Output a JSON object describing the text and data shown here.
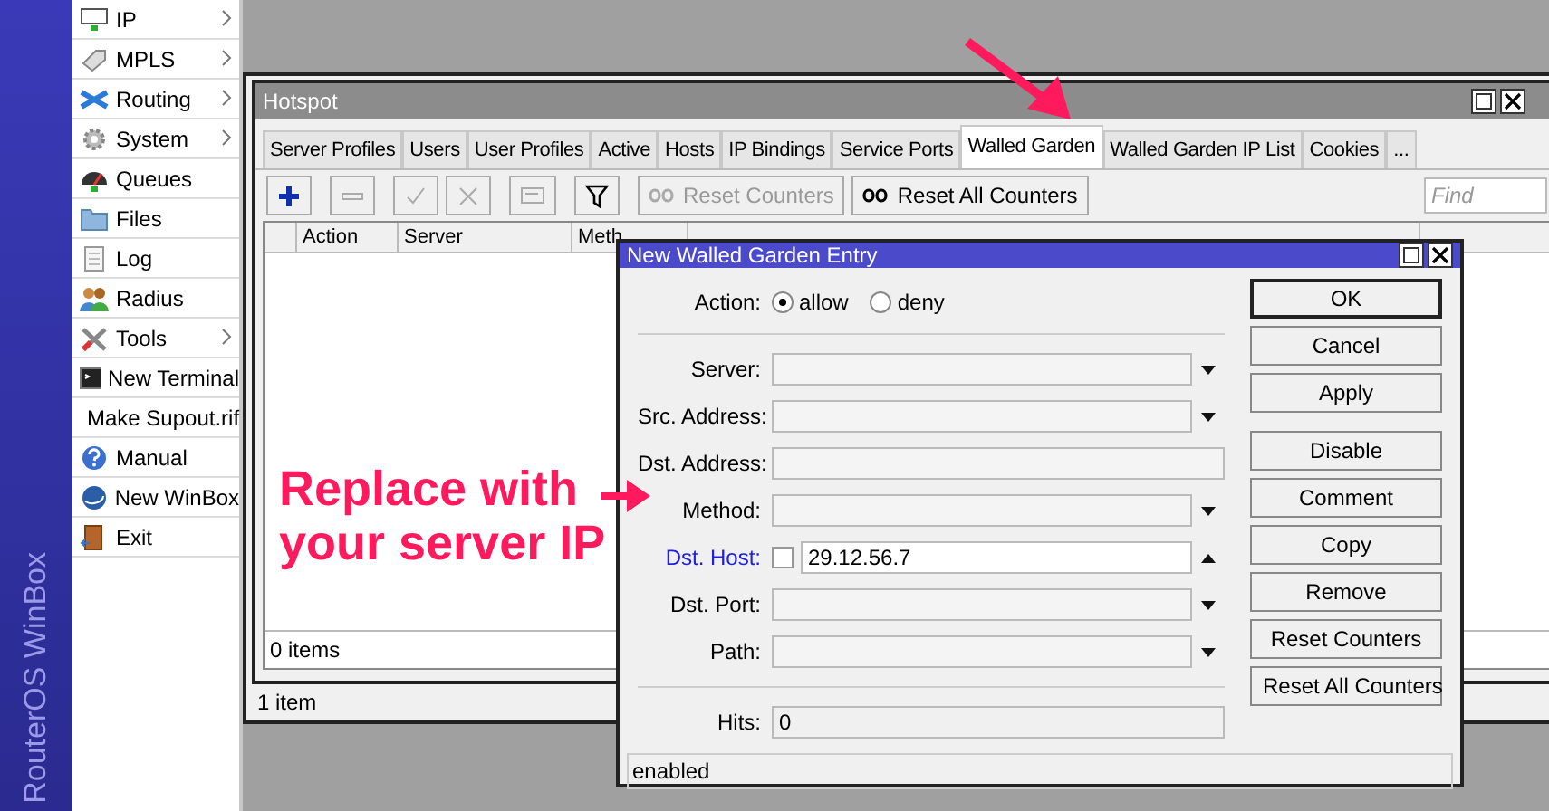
{
  "sidebar": {
    "brand": "RouterOS WinBox",
    "items": [
      {
        "label": "IP",
        "submenu": true
      },
      {
        "label": "MPLS",
        "submenu": true
      },
      {
        "label": "Routing",
        "submenu": true
      },
      {
        "label": "System",
        "submenu": true
      },
      {
        "label": "Queues",
        "submenu": false
      },
      {
        "label": "Files",
        "submenu": false
      },
      {
        "label": "Log",
        "submenu": false
      },
      {
        "label": "Radius",
        "submenu": false
      },
      {
        "label": "Tools",
        "submenu": true
      },
      {
        "label": "New Terminal",
        "submenu": false
      },
      {
        "label": "Make Supout.rif",
        "submenu": false
      },
      {
        "label": "Manual",
        "submenu": false
      },
      {
        "label": "New WinBox",
        "submenu": false
      },
      {
        "label": "Exit",
        "submenu": false
      }
    ]
  },
  "hotspot": {
    "title": "Hotspot",
    "tabs": [
      {
        "label": "Server Profiles",
        "selected": false
      },
      {
        "label": "Users",
        "selected": false
      },
      {
        "label": "User Profiles",
        "selected": false
      },
      {
        "label": "Active",
        "selected": false
      },
      {
        "label": "Hosts",
        "selected": false
      },
      {
        "label": "IP Bindings",
        "selected": false
      },
      {
        "label": "Service Ports",
        "selected": false
      },
      {
        "label": "Walled Garden",
        "selected": true
      },
      {
        "label": "Walled Garden IP List",
        "selected": false
      },
      {
        "label": "Cookies",
        "selected": false
      },
      {
        "label": "...",
        "selected": false
      }
    ],
    "toolbar": [
      {
        "kind": "add",
        "disabled": false
      },
      {
        "kind": "remove",
        "disabled": true
      },
      {
        "kind": "enable",
        "disabled": true
      },
      {
        "kind": "disable",
        "disabled": true
      },
      {
        "kind": "comment",
        "disabled": true
      },
      {
        "kind": "filter",
        "disabled": false
      },
      {
        "kind": "counter",
        "label": "Reset Counters",
        "disabled": true
      },
      {
        "kind": "counter",
        "label": "Reset All Counters",
        "disabled": false
      }
    ],
    "find_placeholder": "Find",
    "columns": [
      "Action",
      "Server",
      "Meth"
    ],
    "status": "0 items"
  },
  "outer_status": "1 item",
  "dialog": {
    "title": "New Walled Garden Entry",
    "action": {
      "label": "Action:",
      "options": [
        {
          "label": "allow",
          "selected": true
        },
        {
          "label": "deny",
          "selected": false
        }
      ]
    },
    "fields": [
      {
        "label": "Server:",
        "kind": "dropdown",
        "highlighted": false
      },
      {
        "label": "Src. Address:",
        "kind": "dropdown",
        "highlighted": false
      },
      {
        "label": "Dst. Address:",
        "kind": "text",
        "highlighted": false
      },
      {
        "label": "Method:",
        "kind": "dropdown",
        "highlighted": false
      },
      {
        "label": "Dst. Host:",
        "kind": "negatable",
        "highlighted": true,
        "checked": false,
        "value": "29.12.56.7"
      },
      {
        "label": "Dst. Port:",
        "kind": "dropdown",
        "highlighted": false
      },
      {
        "label": "Path:",
        "kind": "dropdown",
        "highlighted": false
      }
    ],
    "hits": {
      "label": "Hits:",
      "value": "0"
    },
    "buttons": [
      {
        "label": "OK",
        "default": true
      },
      {
        "label": "Cancel",
        "default": false
      },
      {
        "label": "Apply",
        "default": false
      },
      {
        "label": "Disable",
        "default": false
      },
      {
        "label": "Comment",
        "default": false
      },
      {
        "label": "Copy",
        "default": false
      },
      {
        "label": "Remove",
        "default": false
      },
      {
        "label": "Reset Counters",
        "default": false
      },
      {
        "label": "Reset All Counters",
        "default": false
      }
    ],
    "status": "enabled"
  },
  "annotation": {
    "lines": [
      "Replace with",
      "your server IP"
    ]
  }
}
